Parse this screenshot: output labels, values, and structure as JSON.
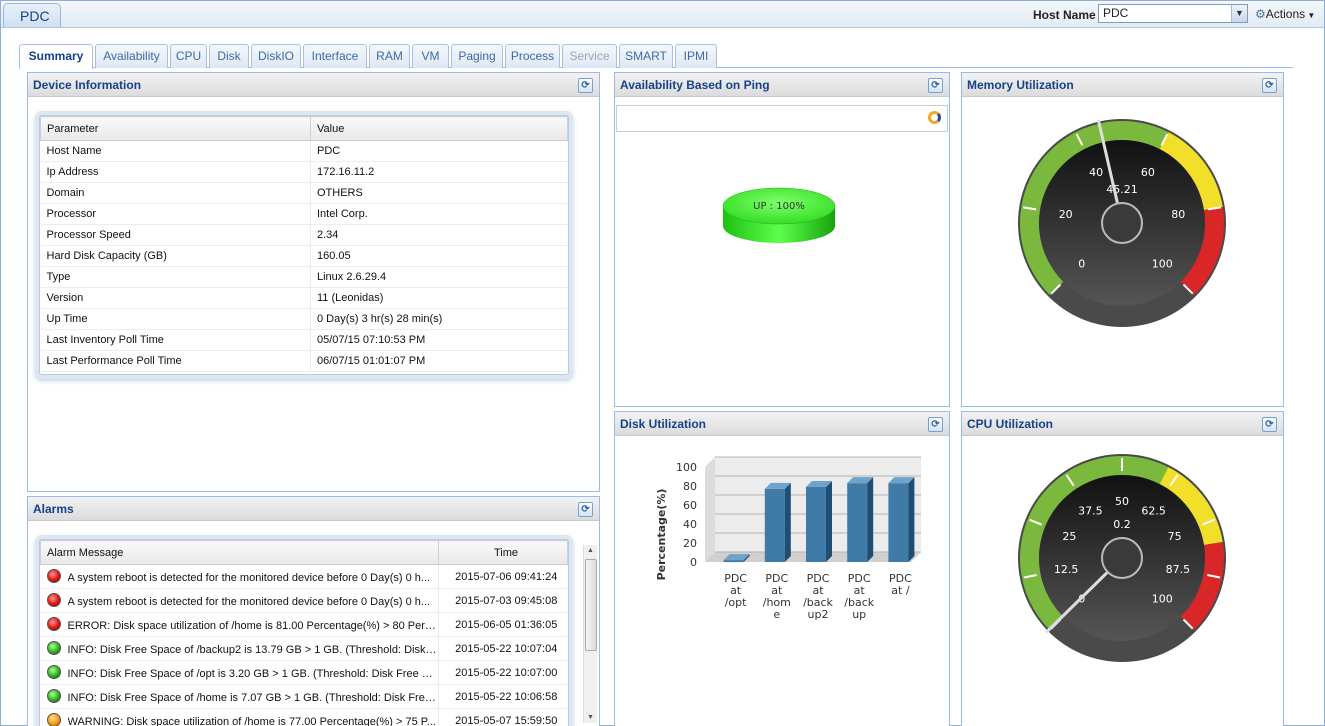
{
  "device_tab": "PDC",
  "host": {
    "label": "Host Name",
    "value": "PDC"
  },
  "actions_label": "Actions",
  "tabs": [
    "Summary",
    "Availability",
    "CPU",
    "Disk",
    "DiskIO",
    "Interface",
    "RAM",
    "VM",
    "Paging",
    "Process",
    "Service",
    "SMART",
    "IPMI"
  ],
  "device_info": {
    "title": "Device Information",
    "columns": [
      "Parameter",
      "Value"
    ],
    "rows": [
      [
        "Host Name",
        "PDC"
      ],
      [
        "Ip Address",
        "172.16.11.2"
      ],
      [
        "Domain",
        "OTHERS"
      ],
      [
        "Processor",
        "Intel Corp."
      ],
      [
        "Processor Speed",
        "2.34"
      ],
      [
        "Hard Disk Capacity (GB)",
        "160.05"
      ],
      [
        "Type",
        "Linux 2.6.29.4"
      ],
      [
        "Version",
        "11 (Leonidas)"
      ],
      [
        "Up Time",
        "0 Day(s) 3 hr(s) 28 min(s)"
      ],
      [
        "Last Inventory Poll Time",
        "05/07/15 07:10:53 PM"
      ],
      [
        "Last Performance Poll Time",
        "06/07/15 01:01:07 PM"
      ]
    ]
  },
  "alarms": {
    "title": "Alarms",
    "columns": [
      "Alarm Message",
      "Time"
    ],
    "rows": [
      {
        "status": "red",
        "message": "A system reboot is detected for the monitored device before 0 Day(s) 0 h...",
        "time": "2015-07-06 09:41:24"
      },
      {
        "status": "red",
        "message": "A system reboot is detected for the monitored device before 0 Day(s) 0 h...",
        "time": "2015-07-03 09:45:08"
      },
      {
        "status": "red",
        "message": "ERROR: Disk space utilization of /home is 81.00 Percentage(%) > 80 Perc...",
        "time": "2015-06-05 01:36:05"
      },
      {
        "status": "green",
        "message": "INFO: Disk Free Space of /backup2 is 13.79 GB > 1 GB. (Threshold: Disk ...",
        "time": "2015-05-22 10:07:04"
      },
      {
        "status": "green",
        "message": "INFO: Disk Free Space of /opt is 3.20 GB > 1 GB. (Threshold: Disk Free S...",
        "time": "2015-05-22 10:07:00"
      },
      {
        "status": "green",
        "message": "INFO: Disk Free Space of /home is 7.07 GB > 1 GB. (Threshold: Disk Free ...",
        "time": "2015-05-22 10:06:58"
      },
      {
        "status": "orange",
        "message": "WARNING: Disk space utilization of /home is 77.00 Percentage(%) > 75 P...",
        "time": "2015-05-07 15:59:50"
      }
    ]
  },
  "availability": {
    "title": "Availability Based on Ping",
    "label": "UP : 100%",
    "value": 100
  },
  "memory": {
    "title": "Memory Utilization",
    "value": 45.21,
    "display": "45.21",
    "ticks": [
      "0",
      "20",
      "40",
      "60",
      "80",
      "100"
    ]
  },
  "cpu": {
    "title": "CPU Utilization",
    "value": 0.2,
    "display": "0.2",
    "ticks": [
      "0",
      "12.5",
      "25",
      "37.5",
      "50",
      "62.5",
      "75",
      "87.5",
      "100"
    ]
  },
  "disk": {
    "title": "Disk Utilization"
  },
  "chart_data": {
    "type": "bar",
    "categories": [
      "PDC at /opt",
      "PDC at /home",
      "PDC at /backup2",
      "PDC at /backup",
      "PDC at /"
    ],
    "category_lines": [
      [
        "PDC",
        "at",
        "/opt"
      ],
      [
        "PDC",
        "at",
        "/hom",
        "e"
      ],
      [
        "PDC",
        "at",
        "/back",
        "up2"
      ],
      [
        "PDC",
        "at",
        "/back",
        "up"
      ],
      [
        "PDC",
        "at /"
      ]
    ],
    "values": [
      2,
      77,
      79,
      83,
      83
    ],
    "ylabel": "Percentage(%)",
    "ylim": [
      0,
      100
    ],
    "yticks": [
      0,
      20,
      40,
      60,
      80,
      100
    ],
    "bar_color": "#3f7ba6"
  },
  "colors": {
    "gauge_green": "#7ab93d",
    "gauge_yellow": "#f2df2a",
    "gauge_red": "#d92626",
    "accent": "#15428b"
  }
}
